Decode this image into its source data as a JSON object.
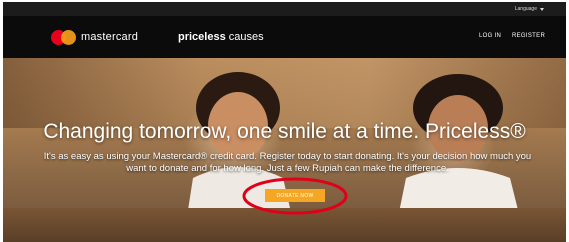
{
  "utility_bar": {
    "language_label": "Language"
  },
  "header": {
    "brand": "mastercard",
    "site_title_bold": "priceless",
    "site_title_rest": " causes",
    "login_label": "LOG IN",
    "register_label": "REGISTER"
  },
  "hero": {
    "headline": "Changing tomorrow, one smile at a time. Priceless®",
    "subtext_line1": "It's as easy as using your Mastercard® credit card. Register today to start donating. It's your decision how much you",
    "subtext_line2": "want to donate and for how long. Just a few Rupiah can make the difference.",
    "donate_label": "DONATE NOW"
  },
  "colors": {
    "brand_red": "#eb001b",
    "brand_orange": "#f79e1b",
    "cta_orange": "#f5a623",
    "highlight_red": "#e0001a",
    "header_bg": "#0b0b0b"
  }
}
